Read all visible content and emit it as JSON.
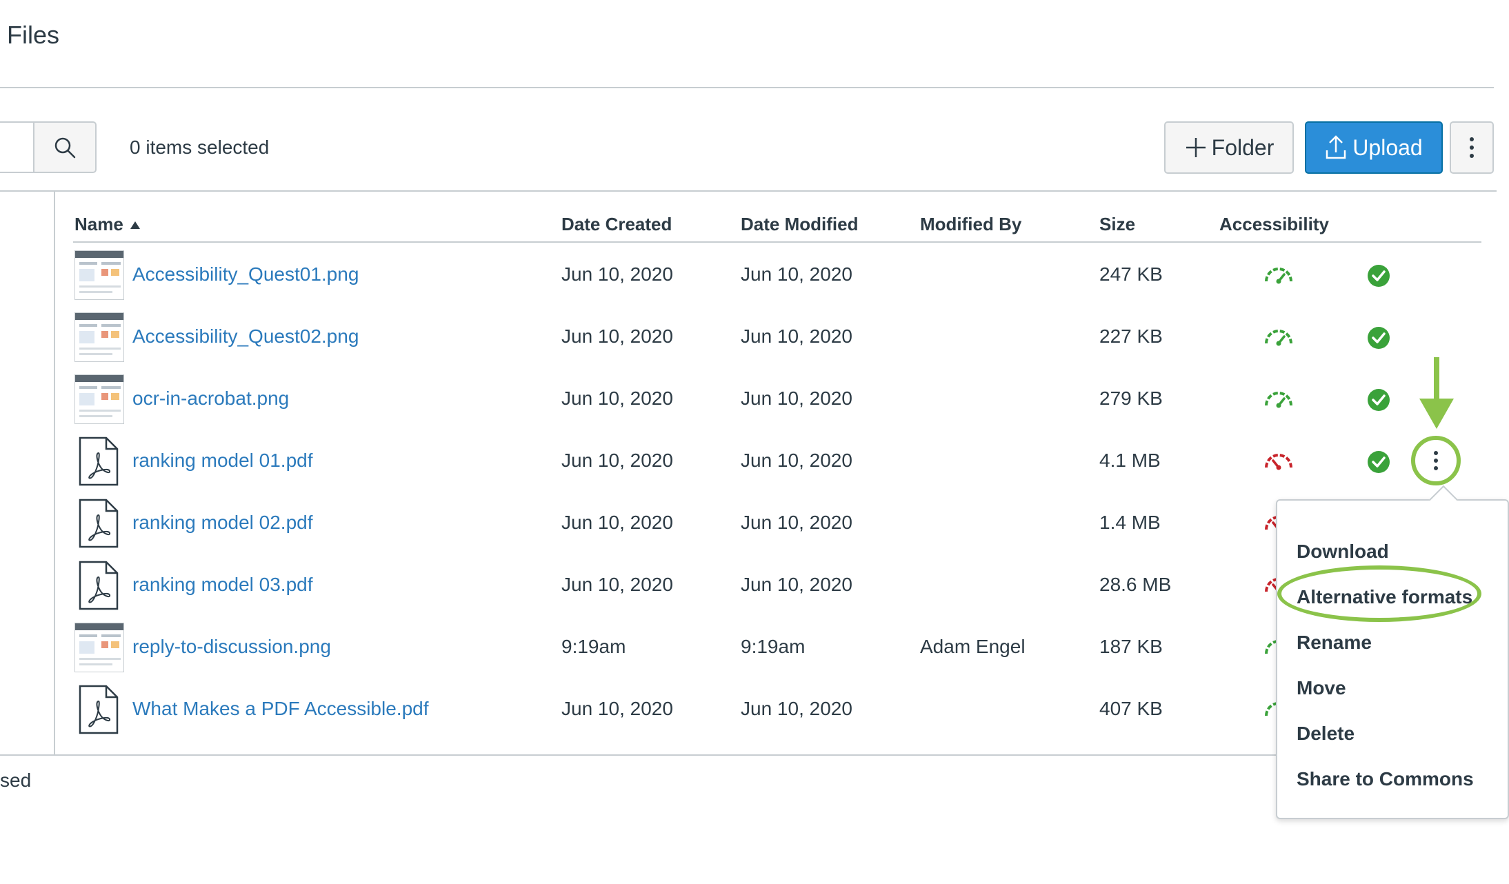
{
  "page": {
    "title": "Files"
  },
  "toolbar": {
    "selected_text": "0 items selected",
    "folder_label": "Folder",
    "upload_label": "Upload",
    "accent": "#2b8ed9"
  },
  "table": {
    "columns": {
      "name": "Name",
      "created": "Date Created",
      "modified": "Date Modified",
      "modified_by": "Modified By",
      "size": "Size",
      "accessibility": "Accessibility"
    },
    "rows": [
      {
        "name": "Accessibility_Quest01.png",
        "created": "Jun 10, 2020",
        "modified": "Jun 10, 2020",
        "modified_by": "",
        "size": "247 KB",
        "icon": "image-thumbnail",
        "accessibility": "good"
      },
      {
        "name": "Accessibility_Quest02.png",
        "created": "Jun 10, 2020",
        "modified": "Jun 10, 2020",
        "modified_by": "",
        "size": "227 KB",
        "icon": "image-thumbnail",
        "accessibility": "good"
      },
      {
        "name": "ocr-in-acrobat.png",
        "created": "Jun 10, 2020",
        "modified": "Jun 10, 2020",
        "modified_by": "",
        "size": "279 KB",
        "icon": "image-thumbnail",
        "accessibility": "good"
      },
      {
        "name": "ranking model 01.pdf",
        "created": "Jun 10, 2020",
        "modified": "Jun 10, 2020",
        "modified_by": "",
        "size": "4.1 MB",
        "icon": "pdf-icon",
        "accessibility": "poor"
      },
      {
        "name": "ranking model 02.pdf",
        "created": "Jun 10, 2020",
        "modified": "Jun 10, 2020",
        "modified_by": "",
        "size": "1.4 MB",
        "icon": "pdf-icon",
        "accessibility": "poor"
      },
      {
        "name": "ranking model 03.pdf",
        "created": "Jun 10, 2020",
        "modified": "Jun 10, 2020",
        "modified_by": "",
        "size": "28.6 MB",
        "icon": "pdf-icon",
        "accessibility": "poor"
      },
      {
        "name": "reply-to-discussion.png",
        "created": "9:19am",
        "modified": "9:19am",
        "modified_by": "Adam Engel",
        "size": "187 KB",
        "icon": "image-thumbnail",
        "accessibility": "good"
      },
      {
        "name": "What Makes a PDF Accessible.pdf",
        "created": "Jun 10, 2020",
        "modified": "Jun 10, 2020",
        "modified_by": "",
        "size": "407 KB",
        "icon": "pdf-icon",
        "accessibility": "good"
      }
    ]
  },
  "context_menu": {
    "items": [
      "Download",
      "Alternative formats",
      "Rename",
      "Move",
      "Delete",
      "Share to Commons"
    ],
    "highlighted": "Alternative formats"
  },
  "footer": {
    "text": "sed"
  },
  "colors": {
    "link": "#2b7abc",
    "good": "#3aa23a",
    "poor": "#c8242b",
    "highlight": "#8bc34a",
    "border": "#c7cdd1"
  }
}
